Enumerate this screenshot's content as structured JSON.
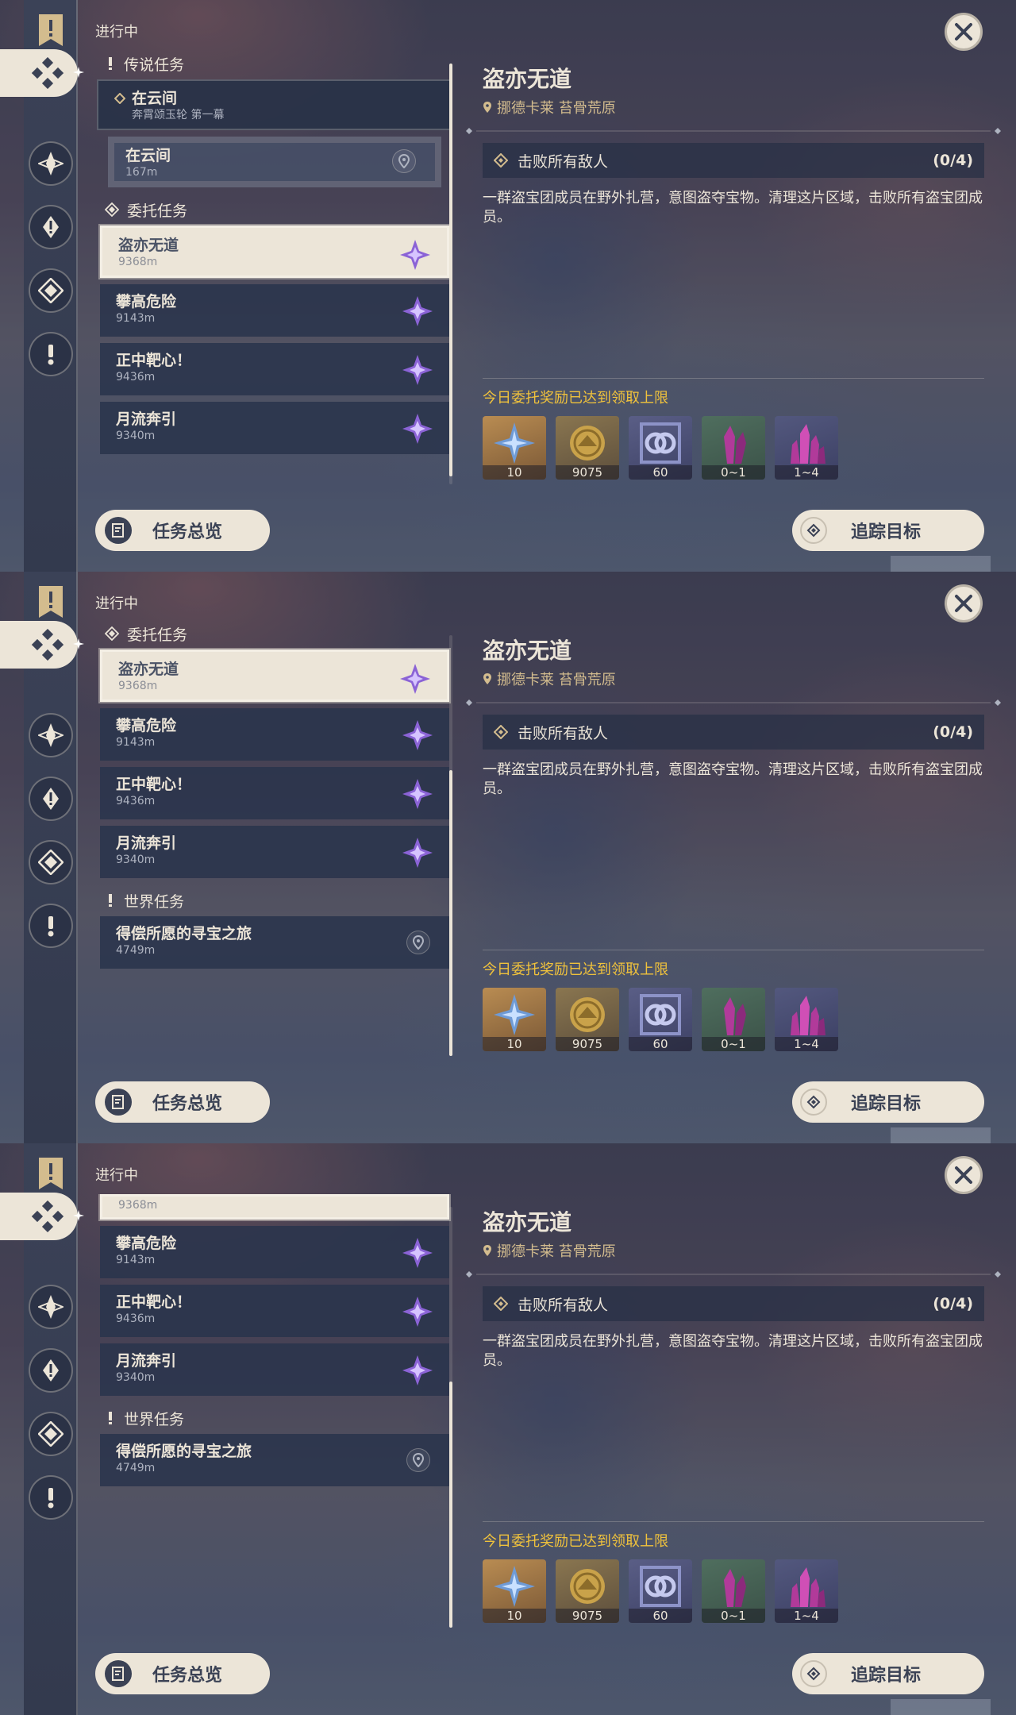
{
  "panels": [
    {
      "header": {
        "status_label": "进行中"
      },
      "legend_section": {
        "label": "传说任务",
        "parent": {
          "title": "在云间",
          "subtitle": "奔霄颂玉轮 第一幕"
        },
        "child": {
          "title": "在云间",
          "distance": "167m"
        }
      },
      "commission_section": {
        "label": "委托任务"
      },
      "commissions": [
        {
          "title": "盗亦无道",
          "distance": "9368m"
        },
        {
          "title": "攀高危险",
          "distance": "9143m"
        },
        {
          "title": "正中靶心！",
          "distance": "9436m"
        },
        {
          "title": "月流奔引",
          "distance": "9340m"
        }
      ]
    },
    {
      "header": {
        "status_label": "进行中"
      },
      "commission_section": {
        "label": "委托任务"
      },
      "commissions": [
        {
          "title": "盗亦无道",
          "distance": "9368m"
        },
        {
          "title": "攀高危险",
          "distance": "9143m"
        },
        {
          "title": "正中靶心！",
          "distance": "9436m"
        },
        {
          "title": "月流奔引",
          "distance": "9340m"
        }
      ],
      "world_section": {
        "label": "世界任务"
      },
      "world_quests": [
        {
          "title": "得偿所愿的寻宝之旅",
          "distance": "4749m"
        }
      ]
    },
    {
      "header": {
        "status_label": "进行中"
      },
      "partial_card": {
        "distance": "9368m"
      },
      "commissions": [
        {
          "title": "攀高危险",
          "distance": "9143m"
        },
        {
          "title": "正中靶心！",
          "distance": "9436m"
        },
        {
          "title": "月流奔引",
          "distance": "9340m"
        }
      ],
      "world_section": {
        "label": "世界任务"
      },
      "world_quests": [
        {
          "title": "得偿所愿的寻宝之旅",
          "distance": "4749m"
        }
      ]
    }
  ],
  "detail": {
    "title": "盗亦无道",
    "location": "挪德卡莱 苔骨荒原",
    "objective": {
      "text": "击败所有敌人",
      "count": "(0/4)"
    },
    "description": "一群盗宝团成员在野外扎营，意图盗夺宝物。清理这片区域，击败所有盗宝团成员。",
    "reward_notice": "今日委托奖励已达到领取上限",
    "rewards": [
      {
        "icon": "adventure-exp-icon",
        "count": "10"
      },
      {
        "icon": "mora-icon",
        "count": "9075"
      },
      {
        "icon": "reputation-icon",
        "count": "60"
      },
      {
        "icon": "crystal-icon",
        "count": "0~1"
      },
      {
        "icon": "crystal-cluster-icon",
        "count": "1~4"
      }
    ]
  },
  "buttons": {
    "overview": "任务总览",
    "track": "追踪目标"
  },
  "colors": {
    "accent_gold": "#d3bc8e",
    "notice_yellow": "#f0c23c",
    "panel_cream": "#ece5d8",
    "card_dark": "#2a344c",
    "commission_purple": "#8b63d6"
  }
}
